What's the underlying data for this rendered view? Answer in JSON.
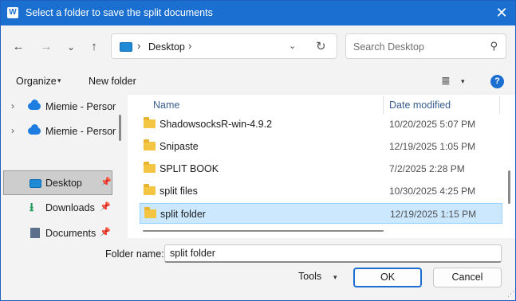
{
  "window": {
    "title": "Select a folder to save the split documents",
    "app_icon": "W",
    "close_glyph": "✕"
  },
  "navigation": {
    "back_glyph": "←",
    "forward_glyph": "→",
    "recent_glyph": "⌄",
    "up_glyph": "↑",
    "address": {
      "location": "Desktop",
      "sep_glyph": "›",
      "dropdown_glyph": "⌄",
      "refresh_glyph": "↻"
    },
    "search": {
      "placeholder": "Search Desktop",
      "icon_glyph": "⚲"
    }
  },
  "commandbar": {
    "organize_label": "Organize",
    "caret_glyph": "▾",
    "new_folder_label": "New folder",
    "view_glyph": "≣",
    "help_glyph": "?"
  },
  "navpane": {
    "chevron_glyph": "›",
    "pin_glyph": "📌",
    "items": [
      {
        "label": "Miemie - Persor"
      },
      {
        "label": "Miemie - Persor"
      },
      {
        "label": "Desktop"
      },
      {
        "label": "Downloads",
        "icon_glyph": "⭳"
      },
      {
        "label": "Documents"
      }
    ]
  },
  "filelist": {
    "sort_glyph": "⌃",
    "columns": {
      "name": "Name",
      "date": "Date modified"
    },
    "rows": [
      {
        "name": "ShadowsocksR-win-4.9.2",
        "date": "10/20/2025 5:07 PM"
      },
      {
        "name": "Snipaste",
        "date": "12/19/2025 1:05 PM"
      },
      {
        "name": "SPLIT BOOK",
        "date": "7/2/2025 2:28 PM"
      },
      {
        "name": "split files",
        "date": "10/30/2025 4:25 PM"
      },
      {
        "name": "split folder",
        "date": "12/19/2025 1:15 PM"
      }
    ]
  },
  "footer": {
    "folder_name_label": "Folder name:",
    "folder_name_value": "split folder",
    "tools_label": "Tools",
    "ok_label": "OK",
    "cancel_label": "Cancel",
    "grip_glyph": "⋰"
  },
  "colors": {
    "accent": "#1a6fd0",
    "selection": "#cce8ff",
    "folder": "#f4c542"
  }
}
